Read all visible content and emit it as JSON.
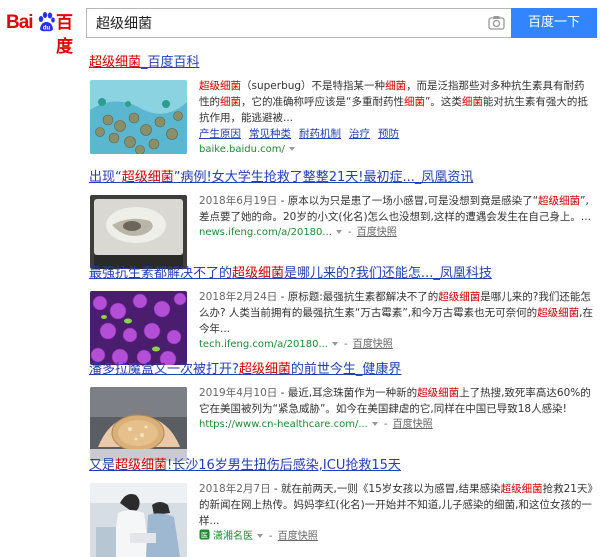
{
  "header": {
    "logo_left": "Bai",
    "logo_right": "百度",
    "search_value": "超级细菌",
    "button_label": "百度一下"
  },
  "colors": {
    "link": "#2440b3",
    "highlight": "#cc0000",
    "source": "#1e8a32",
    "button": "#3385ff",
    "brand": "#e10602"
  },
  "results": [
    {
      "title": [
        {
          "t": "超级细菌",
          "hl": true
        },
        {
          "t": "_百度百科",
          "hl": false
        }
      ],
      "date": "",
      "snippet": [
        {
          "t": "超级细菌",
          "hl": true
        },
        {
          "t": "（superbug）不是特指某一种",
          "hl": false
        },
        {
          "t": "细菌",
          "hl": true
        },
        {
          "t": "，而是泛指那些对多种抗生素具有耐药性的",
          "hl": false
        },
        {
          "t": "细菌",
          "hl": true
        },
        {
          "t": "，它的准确称呼应该是“多重耐药性",
          "hl": false
        },
        {
          "t": "细菌",
          "hl": true
        },
        {
          "t": "”。这类",
          "hl": false
        },
        {
          "t": "细菌",
          "hl": true
        },
        {
          "t": "能对抗生素有强大的抵抗作用，能逃避被...",
          "hl": false
        }
      ],
      "links": [
        "产生原因",
        "常见种类",
        "耐药机制",
        "治疗",
        "预防"
      ],
      "source": "baike.baidu.com/",
      "snapshot": ""
    },
    {
      "title": [
        {
          "t": "出现“",
          "hl": false
        },
        {
          "t": "超级细菌",
          "hl": true
        },
        {
          "t": "”病例!女大学生抢救了整整21天!最初症..._凤凰资讯",
          "hl": false
        }
      ],
      "date": "2018年6月19日",
      "snippet": [
        {
          "t": " - 原本以为只是患了一场小感冒,可是没想到竟是感染了“",
          "hl": false
        },
        {
          "t": "超级细菌",
          "hl": true
        },
        {
          "t": "”,差点要了她的命。20岁的小文(化名)怎么也没想到,这样的遭遇会发生在自己身上。...",
          "hl": false
        }
      ],
      "links": [],
      "source": "news.ifeng.com/a/20180...",
      "snapshot": "百度快照"
    },
    {
      "title": [
        {
          "t": "最强抗生素都解决不了的",
          "hl": false
        },
        {
          "t": "超级细菌",
          "hl": true
        },
        {
          "t": "是哪儿来的?我们还能怎..._凤凰科技",
          "hl": false
        }
      ],
      "date": "2018年2月24日",
      "snippet": [
        {
          "t": " - 原标题:最强抗生素都解决不了的",
          "hl": false
        },
        {
          "t": "超级细菌",
          "hl": true
        },
        {
          "t": "是哪儿来的?我们还能怎么办? 人类当前拥有的最强抗生素“万古霉素”,和今万古霉素也无可奈何的",
          "hl": false
        },
        {
          "t": "超级细菌",
          "hl": true
        },
        {
          "t": ",在今年...",
          "hl": false
        }
      ],
      "links": [],
      "source": "tech.ifeng.com/a/20180...",
      "snapshot": "百度快照"
    },
    {
      "title": [
        {
          "t": "潘多拉魔盒又一次被打开?",
          "hl": false
        },
        {
          "t": "超级细菌",
          "hl": true
        },
        {
          "t": "的前世今生_健康界",
          "hl": false
        }
      ],
      "date": "2019年4月10日",
      "snippet": [
        {
          "t": " - 最近,耳念珠菌作为一种新的",
          "hl": false
        },
        {
          "t": "超级细菌",
          "hl": true
        },
        {
          "t": "上了热搜,致死率高达60%的它在美国被列为“紧急威胁”。如今在美国肆虐的它,同样在中国已导致18人感染!",
          "hl": false
        }
      ],
      "links": [],
      "source": "https://www.cn-healthcare.com/...",
      "snapshot": "百度快照"
    },
    {
      "title": [
        {
          "t": "又是",
          "hl": false
        },
        {
          "t": "超级细菌",
          "hl": true
        },
        {
          "t": "!长沙16岁男生扭伤后感染,ICU抢救15天",
          "hl": false
        }
      ],
      "date": "2018年2月7日",
      "snippet": [
        {
          "t": " - 就在前两天,一则《15岁女孩以为感冒,结果感染",
          "hl": false
        },
        {
          "t": "超级细菌",
          "hl": true
        },
        {
          "t": "抢救21天》的新闻在网上热传。妈妈李红(化名)一开始并不知道,儿子感染的细菌,和这位女孩的一样...",
          "hl": false
        }
      ],
      "links": [],
      "source": "潇湘名医",
      "snapshot": "百度快照"
    }
  ]
}
